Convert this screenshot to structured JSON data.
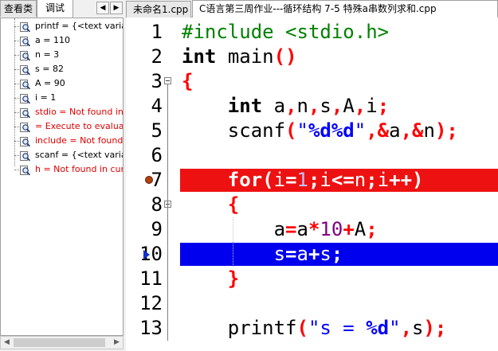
{
  "left_panel": {
    "tabs": [
      "查看类",
      "调试"
    ],
    "scroll_left": "◀",
    "scroll_right": "▶",
    "watch": [
      {
        "text": "printf = {<text variab",
        "status": "ok"
      },
      {
        "text": "a = 110",
        "status": "ok"
      },
      {
        "text": "n = 3",
        "status": "ok"
      },
      {
        "text": "s = 82",
        "status": "ok"
      },
      {
        "text": "A = 90",
        "status": "ok"
      },
      {
        "text": "i = 1",
        "status": "ok"
      },
      {
        "text": "stdio = Not found in",
        "status": "error"
      },
      {
        "text": " = Execute to evaluat",
        "status": "error"
      },
      {
        "text": "include = Not found",
        "status": "error"
      },
      {
        "text": "scanf = {<text variabl",
        "status": "ok"
      },
      {
        "text": "h = Not found in cur",
        "status": "error"
      }
    ],
    "hscroll_left": "◀",
    "hscroll_right": "▶",
    "watch_icon": "magnifier-icon",
    "error_color": "#e00000"
  },
  "editor": {
    "tabs": [
      "未命名1.cpp",
      "C语言第三周作业---循环结构 7-5 特殊a串数列求和.cpp"
    ],
    "active_tab": 1,
    "breakpoint_line": 7,
    "current_line": 10,
    "breakpoint_color": "#ee1111",
    "current_line_color": "#0000ee",
    "line_numbers": [
      "1",
      "2",
      "3",
      "4",
      "5",
      "6",
      "7",
      "8",
      "9",
      "10",
      "11",
      "12",
      "13"
    ],
    "lines": [
      "#include <stdio.h>",
      "int main()",
      "{",
      "    int a,n,s,A,i;",
      "    scanf(\"%d%d\",&a,&n);",
      "",
      "    for(i=1;i<=n;i++)",
      "    {",
      "        a=a*10+A;",
      "        s=a+s;",
      "    }",
      "",
      "    printf(\"s = %d\",s);"
    ]
  }
}
